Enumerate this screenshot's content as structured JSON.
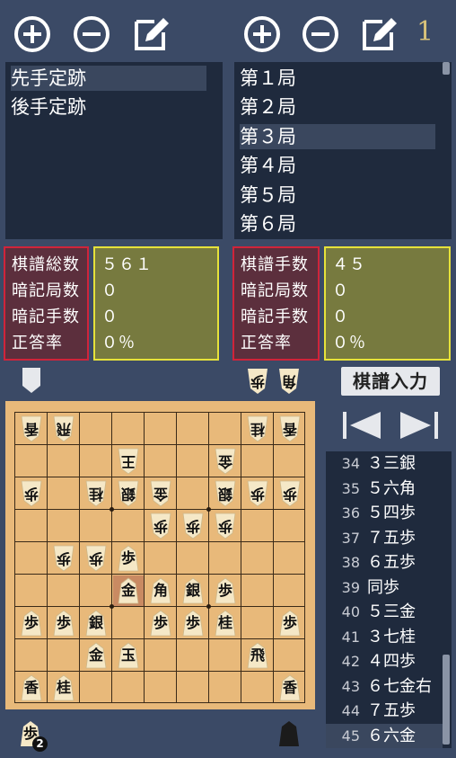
{
  "toolbar": {
    "game_number": "1"
  },
  "joseki_list": {
    "items": [
      {
        "label": "先手定跡",
        "selected": true
      },
      {
        "label": "後手定跡",
        "selected": false
      }
    ]
  },
  "game_list": {
    "items": [
      {
        "label": "第１局",
        "selected": false
      },
      {
        "label": "第２局",
        "selected": false
      },
      {
        "label": "第３局",
        "selected": true
      },
      {
        "label": "第４局",
        "selected": false
      },
      {
        "label": "第５局",
        "selected": false
      },
      {
        "label": "第６局",
        "selected": false
      }
    ]
  },
  "stats_left": {
    "labels": [
      "棋譜総数",
      "暗記局数",
      "暗記手数",
      "正答率"
    ],
    "values": [
      "５６１",
      "０",
      "０",
      "０％"
    ]
  },
  "stats_right": {
    "labels": [
      "棋譜手数",
      "暗記局数",
      "暗記手数",
      "正答率"
    ],
    "values": [
      "４５",
      "０",
      "０",
      "０％"
    ]
  },
  "kifu_input_label": "棋譜入力",
  "hands": {
    "gote": [
      {
        "piece": "歩"
      },
      {
        "piece": "角"
      }
    ],
    "sente": [
      {
        "piece": "歩",
        "count": "2"
      }
    ]
  },
  "board": {
    "pieces": [
      {
        "file": 9,
        "rank": 1,
        "k": "香",
        "side": "gote"
      },
      {
        "file": 8,
        "rank": 1,
        "k": "飛",
        "side": "gote"
      },
      {
        "file": 2,
        "rank": 1,
        "k": "桂",
        "side": "gote"
      },
      {
        "file": 1,
        "rank": 1,
        "k": "香",
        "side": "gote"
      },
      {
        "file": 6,
        "rank": 2,
        "k": "王",
        "side": "gote"
      },
      {
        "file": 3,
        "rank": 2,
        "k": "金",
        "side": "gote"
      },
      {
        "file": 9,
        "rank": 3,
        "k": "歩",
        "side": "gote"
      },
      {
        "file": 7,
        "rank": 3,
        "k": "桂",
        "side": "gote"
      },
      {
        "file": 6,
        "rank": 3,
        "k": "銀",
        "side": "gote"
      },
      {
        "file": 5,
        "rank": 3,
        "k": "金",
        "side": "gote"
      },
      {
        "file": 3,
        "rank": 3,
        "k": "銀",
        "side": "gote"
      },
      {
        "file": 2,
        "rank": 3,
        "k": "歩",
        "side": "gote"
      },
      {
        "file": 1,
        "rank": 3,
        "k": "歩",
        "side": "gote"
      },
      {
        "file": 5,
        "rank": 4,
        "k": "歩",
        "side": "gote"
      },
      {
        "file": 4,
        "rank": 4,
        "k": "歩",
        "side": "gote"
      },
      {
        "file": 3,
        "rank": 4,
        "k": "歩",
        "side": "gote"
      },
      {
        "file": 8,
        "rank": 5,
        "k": "歩",
        "side": "gote"
      },
      {
        "file": 7,
        "rank": 5,
        "k": "歩",
        "side": "gote"
      },
      {
        "file": 6,
        "rank": 5,
        "k": "歩",
        "side": "sente"
      },
      {
        "file": 6,
        "rank": 6,
        "k": "金",
        "side": "sente",
        "last_move": true
      },
      {
        "file": 5,
        "rank": 6,
        "k": "角",
        "side": "sente"
      },
      {
        "file": 4,
        "rank": 6,
        "k": "銀",
        "side": "sente"
      },
      {
        "file": 3,
        "rank": 6,
        "k": "歩",
        "side": "sente"
      },
      {
        "file": 9,
        "rank": 7,
        "k": "歩",
        "side": "sente"
      },
      {
        "file": 8,
        "rank": 7,
        "k": "歩",
        "side": "sente"
      },
      {
        "file": 7,
        "rank": 7,
        "k": "銀",
        "side": "sente"
      },
      {
        "file": 5,
        "rank": 7,
        "k": "歩",
        "side": "sente"
      },
      {
        "file": 4,
        "rank": 7,
        "k": "歩",
        "side": "sente"
      },
      {
        "file": 3,
        "rank": 7,
        "k": "桂",
        "side": "sente"
      },
      {
        "file": 1,
        "rank": 7,
        "k": "歩",
        "side": "sente"
      },
      {
        "file": 7,
        "rank": 8,
        "k": "金",
        "side": "sente"
      },
      {
        "file": 6,
        "rank": 8,
        "k": "玉",
        "side": "sente"
      },
      {
        "file": 2,
        "rank": 8,
        "k": "飛",
        "side": "sente"
      },
      {
        "file": 9,
        "rank": 9,
        "k": "香",
        "side": "sente"
      },
      {
        "file": 8,
        "rank": 9,
        "k": "桂",
        "side": "sente"
      },
      {
        "file": 1,
        "rank": 9,
        "k": "香",
        "side": "sente"
      }
    ]
  },
  "moves": [
    {
      "n": "34",
      "t": "３三銀"
    },
    {
      "n": "35",
      "t": "５六角"
    },
    {
      "n": "36",
      "t": "５四歩"
    },
    {
      "n": "37",
      "t": "７五歩"
    },
    {
      "n": "38",
      "t": "６五歩"
    },
    {
      "n": "39",
      "t": "同歩"
    },
    {
      "n": "40",
      "t": "５三金"
    },
    {
      "n": "41",
      "t": "３七桂"
    },
    {
      "n": "42",
      "t": "４四歩"
    },
    {
      "n": "43",
      "t": "６七金右"
    },
    {
      "n": "44",
      "t": "７五歩"
    },
    {
      "n": "45",
      "t": "６六金",
      "selected": true
    }
  ],
  "icons": {
    "add": "plus-circle-icon",
    "remove": "minus-circle-icon",
    "edit": "edit-icon",
    "prev": "prev-triangle-icon",
    "next": "next-triangle-icon"
  },
  "colors": {
    "background": "#3b4a66",
    "panel": "#1f2a3d",
    "stat_label_border": "#d0243a",
    "stat_value_border": "#e6e23a",
    "board": "#e8b97a",
    "last_move_highlight": "#c98a62"
  }
}
